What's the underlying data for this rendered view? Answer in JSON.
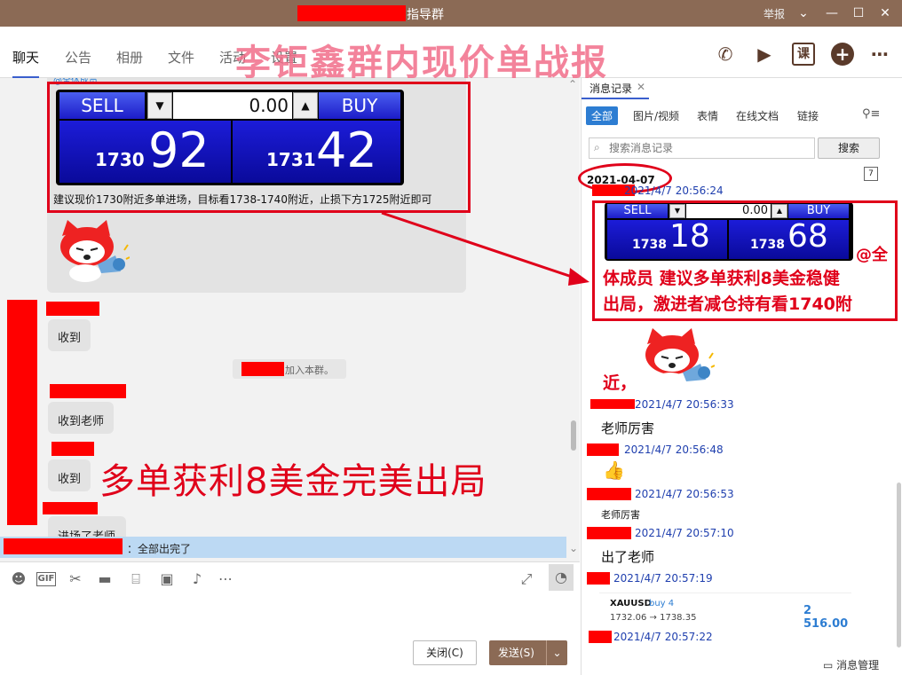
{
  "window": {
    "title": "指导群",
    "report": "举报",
    "controls": [
      "chevron-down",
      "minimize",
      "maximize",
      "close"
    ]
  },
  "nav": {
    "tabs": [
      "聊天",
      "公告",
      "相册",
      "文件",
      "活动",
      "设置"
    ],
    "active": "聊天",
    "watermark": "李钜鑫群内现价单战报",
    "course_icon_label": "课"
  },
  "chat": {
    "mention_link": "@全体成员",
    "trade_panel": {
      "sell_label": "SELL",
      "buy_label": "BUY",
      "volume": "0.00",
      "sell_price_prefix": "1730",
      "sell_price_big": "92",
      "buy_price_prefix": "1731",
      "buy_price_big": "42"
    },
    "advice": "建议现价1730附近多单进场，目标看1738-1740附近，止损下方1725附近即可",
    "messages": [
      {
        "text": "收到"
      },
      {
        "text": "收到老师"
      },
      {
        "text": "收到"
      },
      {
        "text": "进场了老师"
      }
    ],
    "system_notice": "加入本群。",
    "overlay_headline": "多单获利8美金完美出局",
    "reply_bar": "：全部出完了"
  },
  "input": {
    "close_label": "关闭(C)",
    "send_label": "发送(S)",
    "gif_label": "GIF"
  },
  "history": {
    "tab_title": "消息记录",
    "filters": [
      "全部",
      "图片/视频",
      "表情",
      "在线文档",
      "链接"
    ],
    "active_filter": "全部",
    "search_placeholder": "搜索消息记录",
    "search_button": "搜索",
    "date": "2021-04-07",
    "calendar_day": "7",
    "entries": [
      {
        "time": "2021/4/7 20:56:24"
      },
      {
        "time": "2021/4/7 20:56:33",
        "text": "老师厉害"
      },
      {
        "time": "2021/4/7 20:56:48"
      },
      {
        "time": "2021/4/7 20:56:53",
        "text": "老师厉害"
      },
      {
        "time": "2021/4/7 20:57:10",
        "text": "出了老师"
      },
      {
        "time": "2021/4/7 20:57:19"
      },
      {
        "time": "2021/4/7 20:57:22"
      }
    ],
    "trade_panel": {
      "sell_label": "SELL",
      "buy_label": "BUY",
      "volume": "0.00",
      "sell_price_prefix": "1738",
      "sell_price_big": "18",
      "buy_price_prefix": "1738",
      "buy_price_big": "68"
    },
    "announcement_1": "@全",
    "announcement_2": "体成员  建议多单获利8美金稳健",
    "announcement_3": "出局，激进者减仓持有看1740附",
    "announcement_4": "近，",
    "order": {
      "symbol": "XAUUSD",
      "side": "buy 4",
      "prices": "1732.06 → 1738.35",
      "profit": "2 516.00"
    },
    "manage_label": "消息管理"
  },
  "colors": {
    "titlebar": "#8b6a55",
    "accent": "#2d7dd2",
    "highlight_red": "#e0001a",
    "send_button": "#8b6a55"
  }
}
